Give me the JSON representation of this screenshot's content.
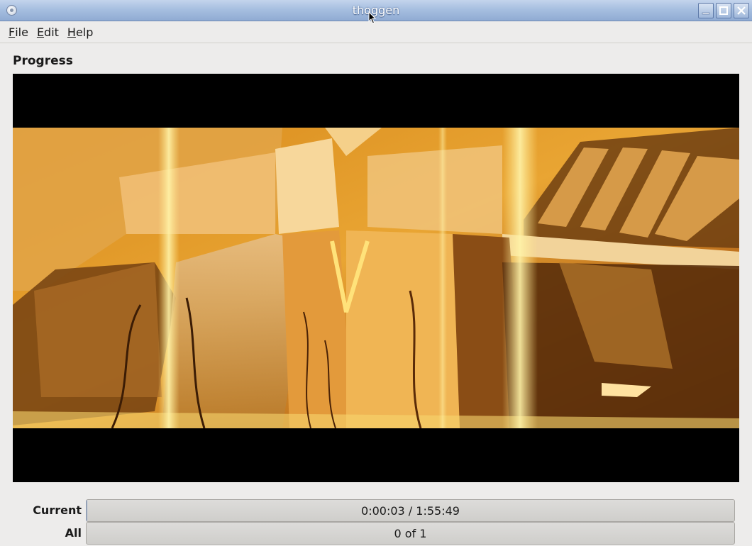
{
  "window": {
    "title": "thoggen"
  },
  "menu": {
    "items": [
      {
        "accel": "F",
        "rest": "ile"
      },
      {
        "accel": "E",
        "rest": "dit"
      },
      {
        "accel": "H",
        "rest": "elp"
      }
    ]
  },
  "main": {
    "section_title": "Progress"
  },
  "progress": {
    "current": {
      "label": "Current",
      "text": "0:00:03 / 1:55:49",
      "fraction": 0.0004
    },
    "all": {
      "label": "All",
      "text": "0 of 1",
      "fraction": 0
    }
  },
  "icons": {
    "window_menu": "window-menu-icon",
    "minimize": "minimize-icon",
    "maximize": "maximize-icon",
    "close": "close-icon"
  },
  "colors": {
    "titlebar": "#a7bfe0",
    "background": "#edeceb",
    "video_background": "#000000",
    "frame_tint": "#e8a12e"
  }
}
